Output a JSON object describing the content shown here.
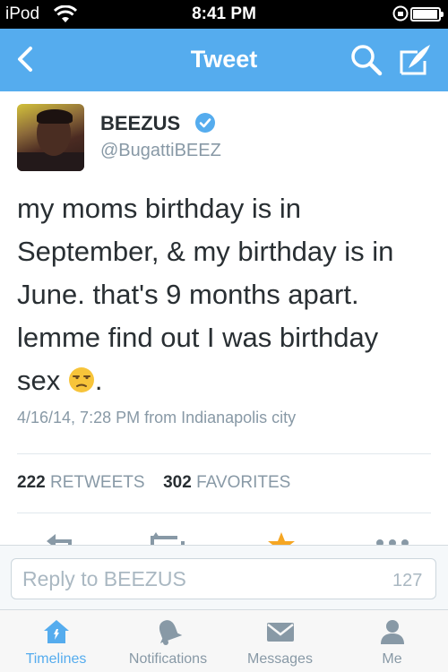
{
  "status_bar": {
    "device": "iPod",
    "time": "8:41 PM"
  },
  "nav": {
    "title": "Tweet"
  },
  "tweet": {
    "display_name": "BEEZUS",
    "handle": "@BugattiBEEZ",
    "text_lines": [
      "my moms birthday is in",
      "September, & my birthday is in",
      "June. that's 9 months apart.",
      "lemme find out I was birthday"
    ],
    "text_last_prefix": "sex ",
    "text_last_suffix": ".",
    "meta": "4/16/14, 7:28 PM from Indianapolis city",
    "retweets_count": "222",
    "retweets_label": "RETWEETS",
    "favorites_count": "302",
    "favorites_label": "FAVORITES"
  },
  "reply": {
    "placeholder": "Reply to BEEZUS",
    "char_count": "127"
  },
  "tabs": [
    {
      "label": "Timelines",
      "icon": "home-icon"
    },
    {
      "label": "Notifications",
      "icon": "bell-icon"
    },
    {
      "label": "Messages",
      "icon": "envelope-icon"
    },
    {
      "label": "Me",
      "icon": "person-icon"
    }
  ],
  "colors": {
    "brand": "#55acee",
    "text": "#292f33",
    "secondary": "#8899a6",
    "favorite": "#f5a623"
  }
}
